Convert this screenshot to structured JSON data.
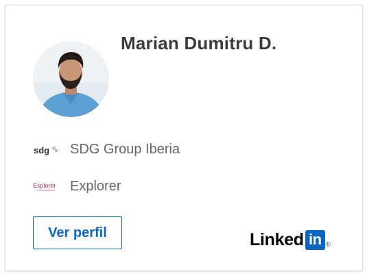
{
  "profile": {
    "name": "Marian Dumitru D.",
    "avatar_icon": "profile-photo"
  },
  "positions": [
    {
      "logo_text": "sdg",
      "company": "SDG Group Iberia"
    },
    {
      "logo_text": "Explorer",
      "company": "Explorer"
    }
  ],
  "actions": {
    "view_profile_label": "Ver perfil"
  },
  "branding": {
    "linkedin_word": "Linked",
    "linkedin_in": "in",
    "registered_mark": "®",
    "accent_color": "#0a66c2"
  }
}
